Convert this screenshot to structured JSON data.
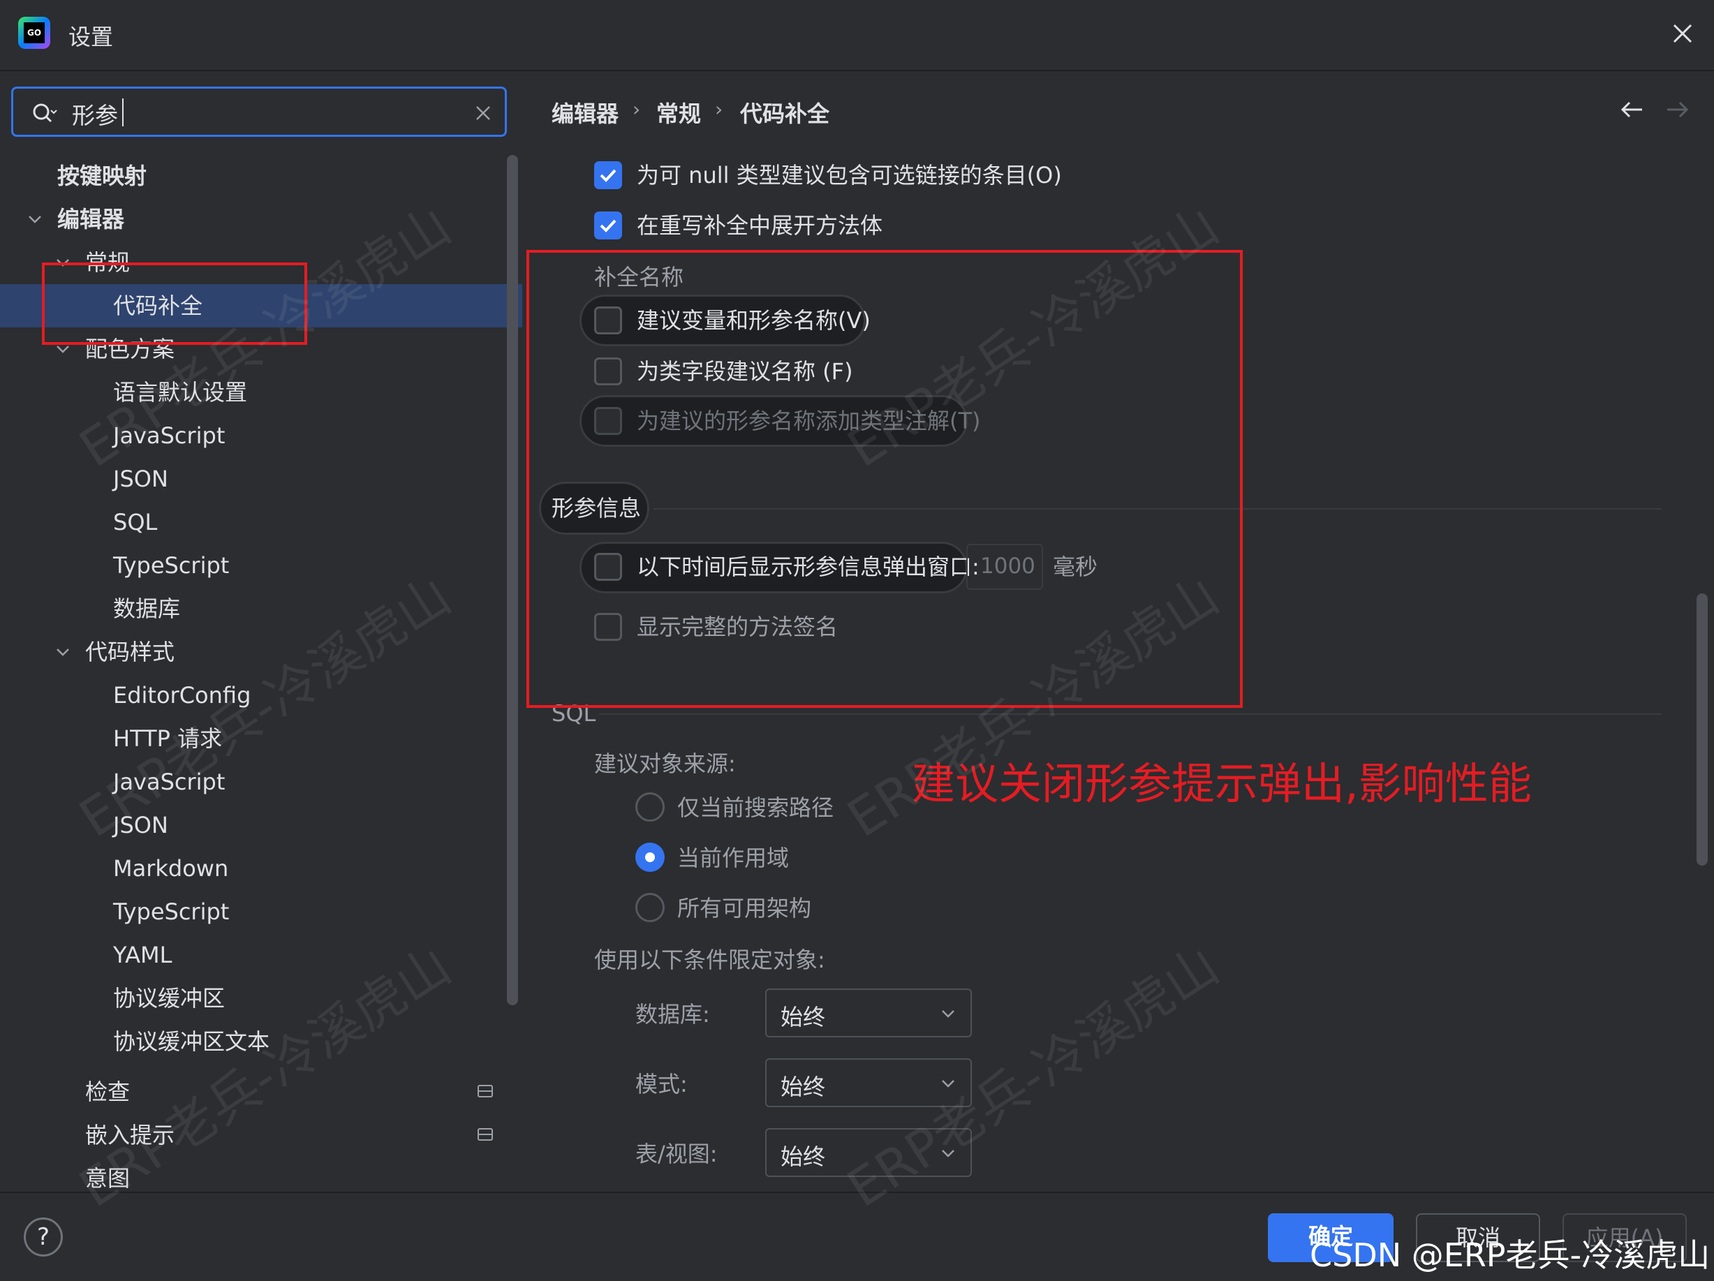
{
  "window": {
    "title": "设置"
  },
  "search": {
    "value": "形参"
  },
  "breadcrumb": {
    "items": [
      "编辑器",
      "常规",
      "代码补全"
    ],
    "separator": "›"
  },
  "tree": {
    "keymap": "按键映射",
    "editor": "编辑器",
    "general": "常规",
    "code_completion": "代码补全",
    "color_scheme": "配色方案",
    "color_children": [
      "语言默认设置",
      "JavaScript",
      "JSON",
      "SQL",
      "TypeScript",
      "数据库"
    ],
    "code_style": "代码样式",
    "style_children": [
      "EditorConfig",
      "HTTP 请求",
      "JavaScript",
      "JSON",
      "Markdown",
      "TypeScript",
      "YAML",
      "协议缓冲区",
      "协议缓冲区文本"
    ],
    "inspections": "检查",
    "inlay_hints": "嵌入提示",
    "intentions": "意图"
  },
  "options": {
    "nullable_chain": "为可 null 类型建议包含可选链接的条目(O)",
    "expand_method_body": "在重写补全中展开方法体"
  },
  "completion_names": {
    "heading": "补全名称",
    "suggest_var_param": "建议变量和形参名称(V)",
    "suggest_class_field": "为类字段建议名称 (F)",
    "add_type_annotation": "为建议的形参名称添加类型注解(T)"
  },
  "param_info": {
    "heading": "形参信息",
    "show_popup": "以下时间后显示形参信息弹出窗口:",
    "delay_value": "1000",
    "delay_unit": "毫秒",
    "show_full_signature": "显示完整的方法签名"
  },
  "sql": {
    "heading": "SQL",
    "source_label": "建议对象来源:",
    "radios": [
      "仅当前搜索路径",
      "当前作用域",
      "所有可用架构"
    ],
    "qualify_label": "使用以下条件限定对象:",
    "rows": [
      {
        "label": "数据库:",
        "value": "始终"
      },
      {
        "label": "模式:",
        "value": "始终"
      },
      {
        "label": "表/视图:",
        "value": "始终"
      }
    ]
  },
  "annotation": "建议关闭形参提示弹出,影响性能",
  "footer": {
    "help": "?",
    "ok": "确定",
    "cancel": "取消",
    "apply": "应用(A)"
  },
  "watermark": "ERP老兵-冷溪虎山",
  "credit": "CSDN @ERP老兵-冷溪虎山",
  "colors": {
    "accent": "#3574f0",
    "annotation": "#e51c23",
    "background": "#2b2d30"
  }
}
